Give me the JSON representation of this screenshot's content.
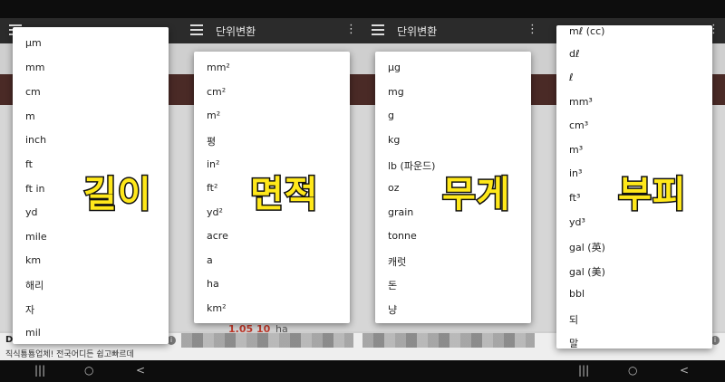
{
  "app": {
    "title": "단위변환"
  },
  "panels": [
    {
      "id": "length",
      "label": "길이",
      "items": [
        "μm",
        "mm",
        "cm",
        "m",
        "inch",
        "ft",
        "ft in",
        "yd",
        "mile",
        "km",
        "해리",
        "자",
        "mil"
      ]
    },
    {
      "id": "area",
      "label": "면적",
      "items": [
        "mm²",
        "cm²",
        "m²",
        "평",
        "in²",
        "ft²",
        "yd²",
        "acre",
        "a",
        "ha",
        "km²"
      ],
      "peek_value": "1.05 10",
      "peek_unit": "ha"
    },
    {
      "id": "weight",
      "label": "무게",
      "items": [
        "μg",
        "mg",
        "g",
        "kg",
        "lb (파운드)",
        "oz",
        "grain",
        "tonne",
        "캐럿",
        "돈",
        "냥"
      ]
    },
    {
      "id": "volume",
      "label": "부피",
      "items": [
        "mℓ (cc)",
        "dℓ",
        "ℓ",
        "mm³",
        "cm³",
        "m³",
        "in³",
        "ft³",
        "yd³",
        "gal (英)",
        "gal (美)",
        "bbl",
        "되",
        "말"
      ]
    }
  ],
  "ad": {
    "text": "직식툥툥업체! 전국어디든 쉽고빠르데",
    "label_left": "D",
    "info_icon": "i"
  },
  "navbar": {
    "recent": "|||",
    "home": "○",
    "back": "<"
  },
  "colors": {
    "highlight": "#ffe81a",
    "appbar": "#2b2b2b",
    "band": "#4a2a26"
  }
}
